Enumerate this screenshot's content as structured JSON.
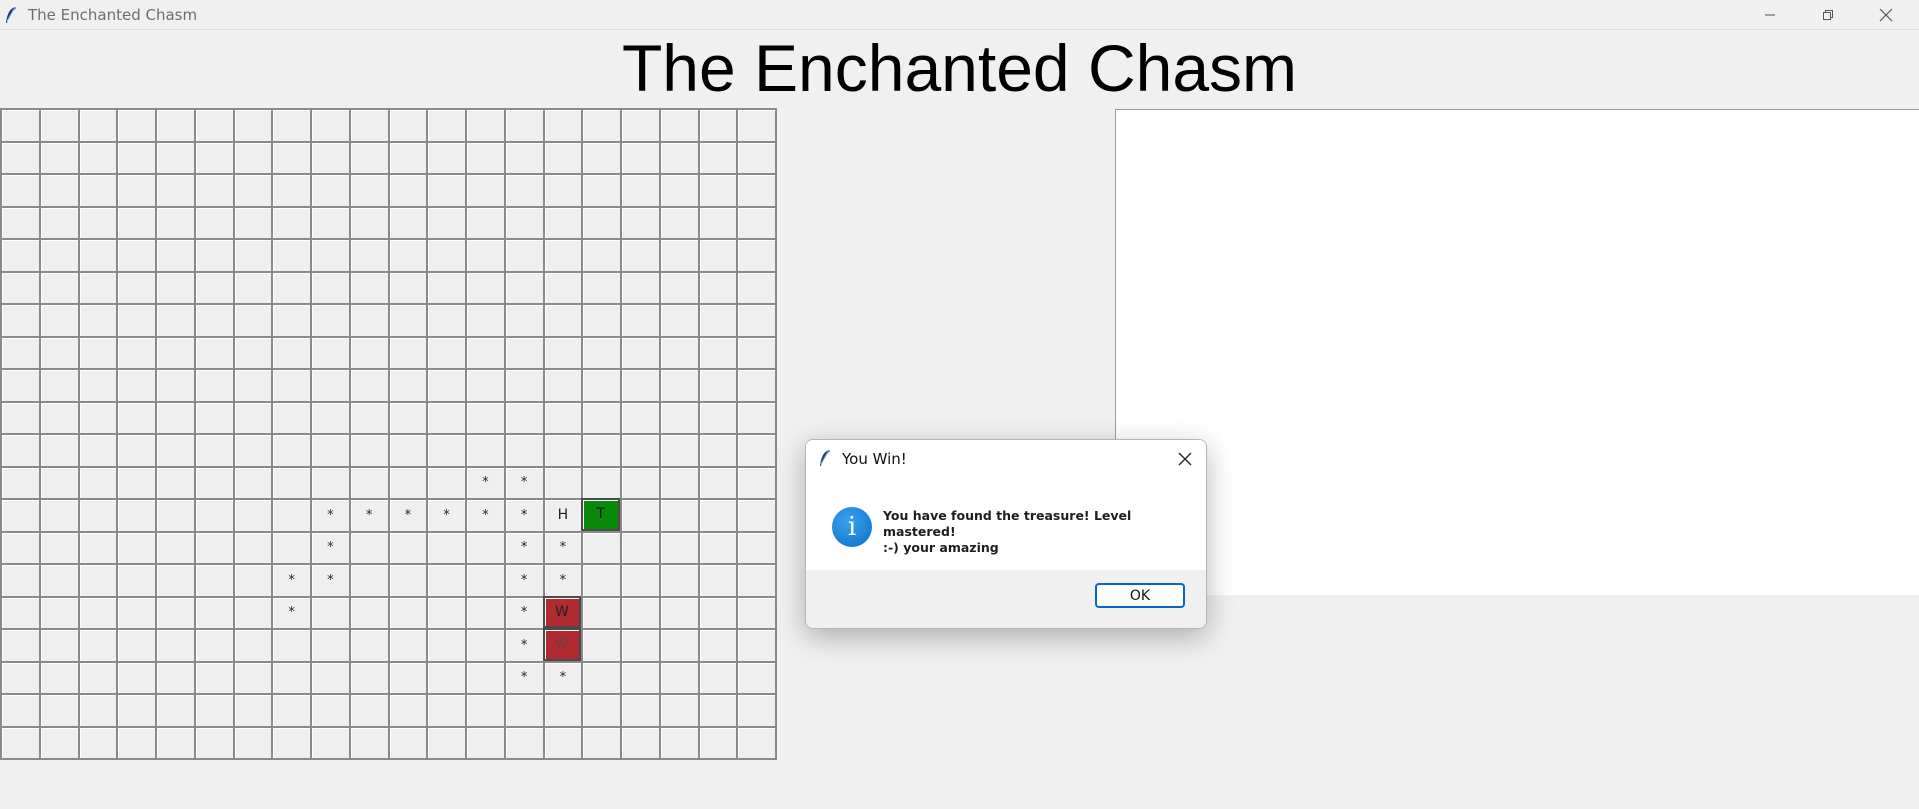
{
  "window": {
    "title": "The Enchanted Chasm",
    "icon": "feather-icon",
    "controls": [
      "minimize-icon",
      "restore-icon",
      "close-icon"
    ]
  },
  "heading": "The Enchanted Chasm",
  "grid": {
    "rows": 20,
    "cols": 20,
    "special_cells": [
      {
        "row": 11,
        "col": 12,
        "text": "*",
        "kind": "path"
      },
      {
        "row": 11,
        "col": 13,
        "text": "*",
        "kind": "path"
      },
      {
        "row": 12,
        "col": 8,
        "text": "*",
        "kind": "path"
      },
      {
        "row": 12,
        "col": 9,
        "text": "*",
        "kind": "path"
      },
      {
        "row": 12,
        "col": 10,
        "text": "*",
        "kind": "path"
      },
      {
        "row": 12,
        "col": 11,
        "text": "*",
        "kind": "path"
      },
      {
        "row": 12,
        "col": 12,
        "text": "*",
        "kind": "path"
      },
      {
        "row": 12,
        "col": 13,
        "text": "*",
        "kind": "path"
      },
      {
        "row": 12,
        "col": 14,
        "text": "H",
        "kind": "hero"
      },
      {
        "row": 12,
        "col": 15,
        "text": "T",
        "kind": "treasure"
      },
      {
        "row": 13,
        "col": 8,
        "text": "*",
        "kind": "path"
      },
      {
        "row": 13,
        "col": 13,
        "text": "*",
        "kind": "path"
      },
      {
        "row": 13,
        "col": 14,
        "text": "*",
        "kind": "path"
      },
      {
        "row": 14,
        "col": 7,
        "text": "*",
        "kind": "path"
      },
      {
        "row": 14,
        "col": 8,
        "text": "*",
        "kind": "path"
      },
      {
        "row": 14,
        "col": 13,
        "text": "*",
        "kind": "path"
      },
      {
        "row": 14,
        "col": 14,
        "text": "*",
        "kind": "path"
      },
      {
        "row": 15,
        "col": 7,
        "text": "*",
        "kind": "path"
      },
      {
        "row": 15,
        "col": 13,
        "text": "*",
        "kind": "path"
      },
      {
        "row": 15,
        "col": 14,
        "text": "W",
        "kind": "wall"
      },
      {
        "row": 16,
        "col": 13,
        "text": "*",
        "kind": "path"
      },
      {
        "row": 16,
        "col": 14,
        "text": "W",
        "kind": "wall-dim"
      },
      {
        "row": 17,
        "col": 13,
        "text": "*",
        "kind": "path"
      },
      {
        "row": 17,
        "col": 14,
        "text": "*",
        "kind": "path"
      }
    ],
    "colors": {
      "treasure": "#078a07",
      "wall": "#b02a2f",
      "cell": "#efefef",
      "line": "#8a8a8a"
    }
  },
  "dialog": {
    "title": "You Win!",
    "message": "You have found the treasure! Level mastered!\n :-) your amazing",
    "icon": "info-icon",
    "ok_label": "OK"
  }
}
